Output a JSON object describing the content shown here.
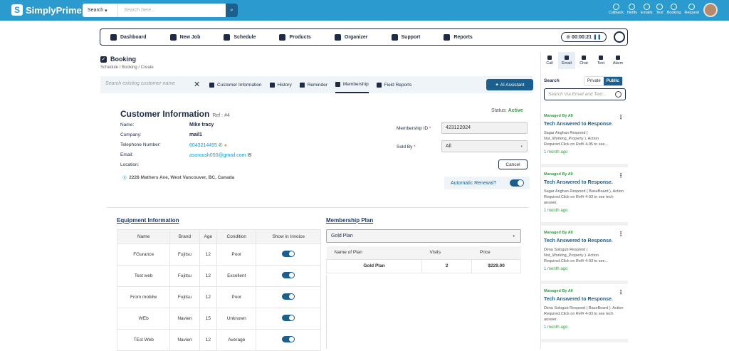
{
  "app": {
    "name": "SimplyPrime"
  },
  "topbar": {
    "search_select": "Search",
    "search_placeholder": "Search here...",
    "icons": [
      {
        "name": "callback-icon",
        "label": "Callback"
      },
      {
        "name": "notify-icon",
        "label": "Notify"
      },
      {
        "name": "emails-icon",
        "label": "Emails"
      },
      {
        "name": "text-icon",
        "label": "Text"
      },
      {
        "name": "booking-icon",
        "label": "Booking"
      },
      {
        "name": "request-icon",
        "label": "Request"
      }
    ]
  },
  "nav": {
    "items": [
      "Dashboard",
      "New Job",
      "Schedule",
      "Products",
      "Organizer",
      "Support",
      "Reports"
    ],
    "timer": "00:00:21"
  },
  "page": {
    "title": "Booking",
    "breadcrumb": "Schedule / Booking / Create"
  },
  "tabbar": {
    "customer_placeholder": "Search existing customer name",
    "tabs": [
      "Customer Information",
      "History",
      "Reminder",
      "Membership",
      "Field Reports"
    ],
    "active_tab": "Membership",
    "ai_button": "AI Assistant"
  },
  "customer": {
    "title": "Customer Information",
    "ref": "Ref : #4",
    "status_label": "Status:",
    "status_value": "Active",
    "name_label": "Name:",
    "name": "Mike tracy",
    "company_label": "Company:",
    "company": "mail1",
    "phone_label": "Telephone Number:",
    "phone": "6043214455",
    "email_label": "Email:",
    "email": "asoroush050@gmail.com",
    "location_label": "Location:",
    "address": "2228 Mathers Ave, West Vancouver, BC, Canada"
  },
  "membership": {
    "id_label": "Membership ID",
    "id_value": "423122024",
    "sold_by_label": "Sold By",
    "sold_by_value": "All",
    "cancel": "Cancel",
    "auto_renewal": "Automatic Renewal?",
    "auto_renewal_on": true
  },
  "equipment": {
    "title": "Equipment Information",
    "columns": [
      "Name",
      "Brand",
      "Age",
      "Condition",
      "Show in Invoice"
    ],
    "rows": [
      [
        "FGurance",
        "Fujitsu",
        "12",
        "Poor"
      ],
      [
        "Test web",
        "Fujitsu",
        "12",
        "Excellent"
      ],
      [
        "From mobilw",
        "Fujitsu",
        "12",
        "Poor"
      ],
      [
        "WEb",
        "Navien",
        "15",
        "Unknown"
      ],
      [
        "TEst Web",
        "Navien",
        "12",
        "Average"
      ]
    ]
  },
  "plan": {
    "title": "Membership Plan",
    "selected": "Gold Plan",
    "columns": [
      "Name of Plan",
      "Visits",
      "Price"
    ],
    "rows": [
      [
        "Gold Plan",
        "2",
        "$229.00"
      ]
    ]
  },
  "right_panel": {
    "tabs": [
      "Call",
      "Email",
      "Chat",
      "Text",
      "Alarm"
    ],
    "active_tab": "Email",
    "search_label": "Search",
    "private": "Private",
    "public": "Public",
    "search_placeholder": "Search Via Email and Text...",
    "cards": [
      {
        "managed": "Managed By All",
        "title": "Tech Answered to Response.",
        "desc": "Sagar Anghan Respond ( Not_Working_Property ). Action Required.Click on Ref# 4-95 to see...",
        "ago": "1 month ago"
      },
      {
        "managed": "Managed By All",
        "title": "Tech Answered to Response.",
        "desc": "Sagar Anghan Respond ( BaseBoard ). Action Required.Click on Ref# 4-93 to see tech answer.",
        "ago": "1 month ago"
      },
      {
        "managed": "Managed By All",
        "title": "Tech Answered to Response.",
        "desc": "Dima Sologub Respond ( Not_Working_Property ). Action Required.Click on Ref# 4-93 to see...",
        "ago": "1 month ago"
      },
      {
        "managed": "Managed By All",
        "title": "Tech Answered to Response.",
        "desc": "Dima Sologub Respond ( BaseBoard ). Action Required.Click on Ref# 4-93 to see tech answer.",
        "ago": "1 month ago"
      }
    ]
  }
}
